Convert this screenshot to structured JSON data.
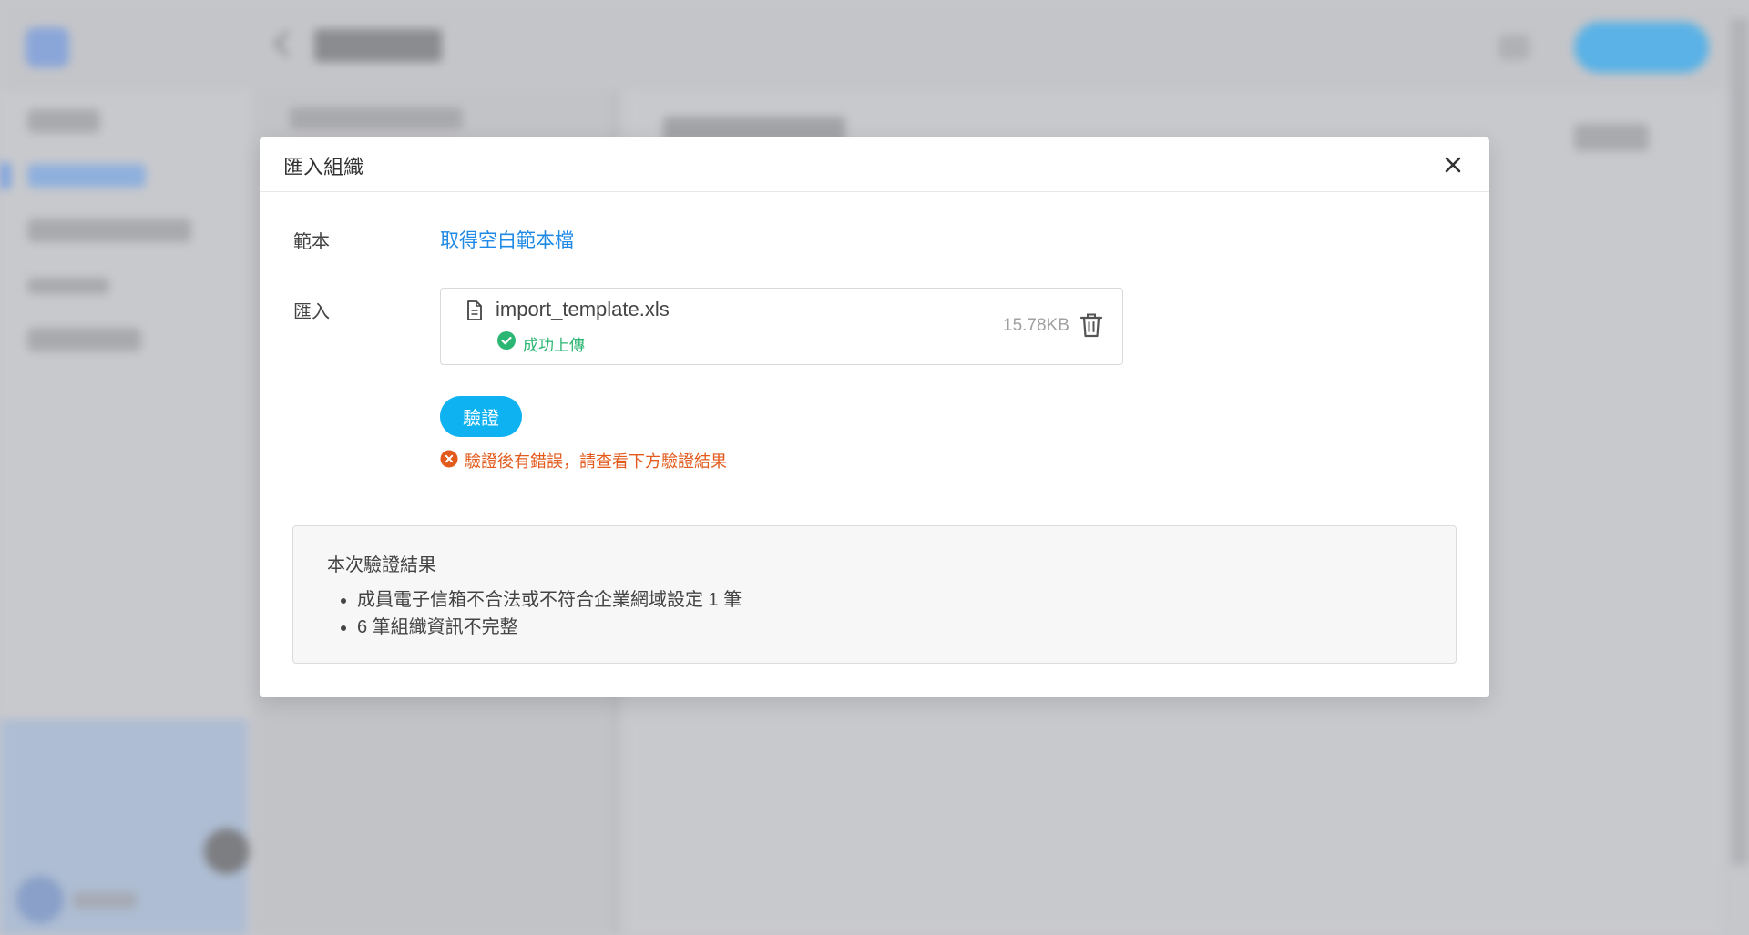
{
  "modal": {
    "title": "匯入組織",
    "template_label": "範本",
    "template_link": "取得空白範本檔",
    "import_label": "匯入",
    "file": {
      "name": "import_template.xls",
      "status": "成功上傳",
      "size": "15.78KB"
    },
    "verify_button": "驗證",
    "error_message": "驗證後有錯誤，請查看下方驗證結果",
    "result": {
      "title": "本次驗證結果",
      "items": [
        "成員電子信箱不合法或不符合企業網域設定 1 筆",
        "6 筆組織資訊不完整"
      ]
    }
  },
  "colors": {
    "link": "#1e8ae6",
    "primary_button": "#0fb2f0",
    "success": "#2bb673",
    "error": "#e25a1c"
  }
}
